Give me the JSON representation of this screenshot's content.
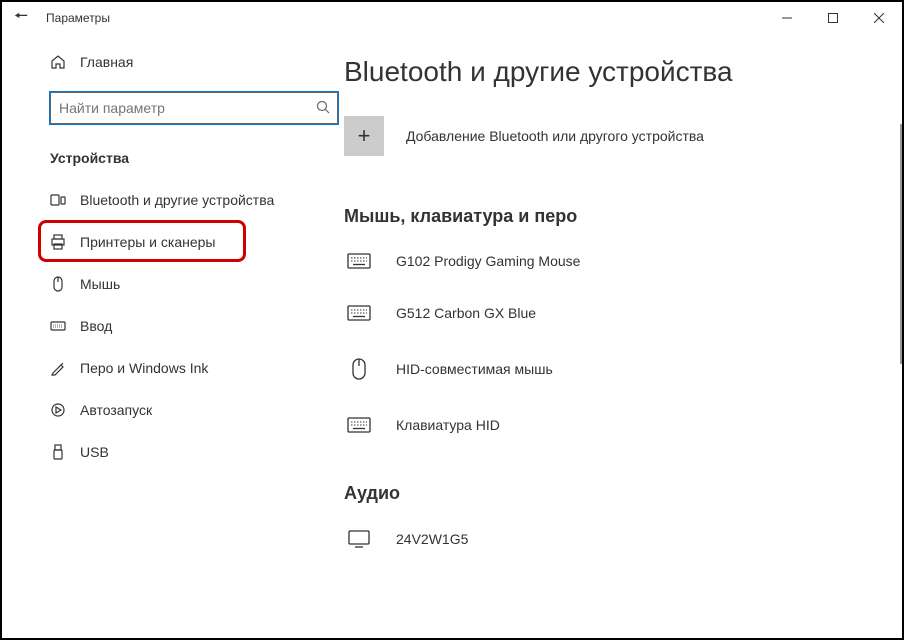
{
  "titlebar": {
    "title": "Параметры"
  },
  "sidebar": {
    "home": "Главная",
    "search_placeholder": "Найти параметр",
    "category": "Устройства",
    "items": [
      {
        "label": "Bluetooth и другие устройства"
      },
      {
        "label": "Принтеры и сканеры"
      },
      {
        "label": "Мышь"
      },
      {
        "label": "Ввод"
      },
      {
        "label": "Перо и Windows Ink"
      },
      {
        "label": "Автозапуск"
      },
      {
        "label": "USB"
      }
    ]
  },
  "content": {
    "heading": "Bluetooth и другие устройства",
    "add_label": "Добавление Bluetooth или другого устройства",
    "section_mouse": "Мышь, клавиатура и перо",
    "devices": [
      {
        "label": "G102 Prodigy Gaming Mouse"
      },
      {
        "label": "G512 Carbon GX Blue"
      },
      {
        "label": "HID-совместимая мышь"
      },
      {
        "label": "Клавиатура HID"
      }
    ],
    "section_audio": "Аудио",
    "audio_devices": [
      {
        "label": "24V2W1G5"
      }
    ]
  }
}
